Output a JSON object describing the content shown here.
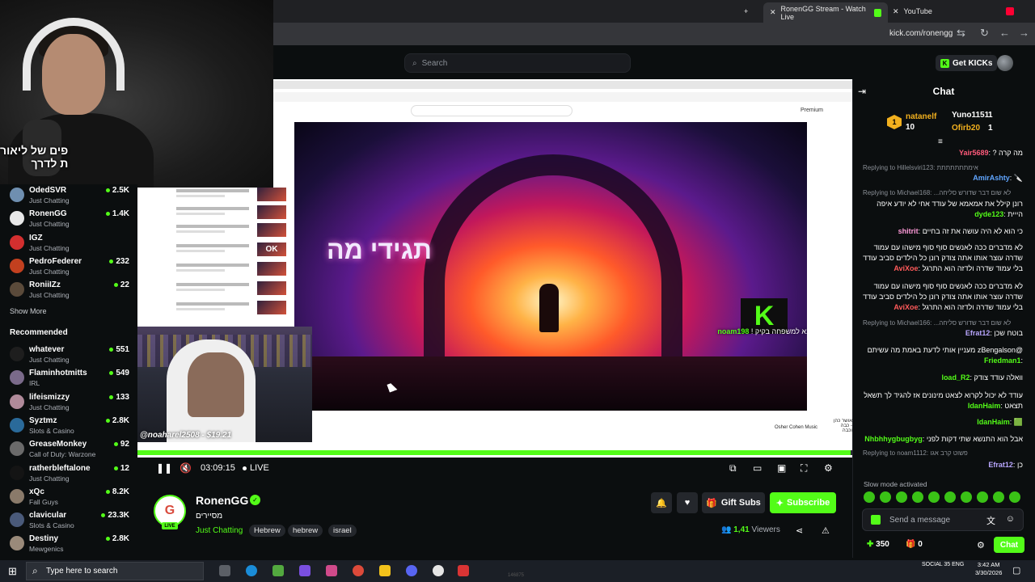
{
  "browser": {
    "tabs": [
      {
        "label": "RonenGG Stream - Watch Live",
        "active": true
      },
      {
        "label": "YouTube",
        "active": false
      }
    ],
    "url": "kick.com/ronengg"
  },
  "header": {
    "search_placeholder": "Search",
    "get_kicks_label": "Get KICKs"
  },
  "sidebar": {
    "following": [
      {
        "name": "OdedSVR",
        "category": "Just Chatting",
        "viewers": "2.5K",
        "avatar_color": "#6f8fb0"
      },
      {
        "name": "RonenGG",
        "category": "Just Chatting",
        "viewers": "1.4K",
        "avatar_color": "#e8e8e8"
      },
      {
        "name": "IGZ",
        "category": "Just Chatting",
        "viewers": "",
        "avatar_color": "#d32f2f"
      },
      {
        "name": "PedroFederer",
        "category": "Just Chatting",
        "viewers": "232",
        "avatar_color": "#c2401f"
      },
      {
        "name": "RoniiIZz",
        "category": "Just Chatting",
        "viewers": "22",
        "avatar_color": "#5a4a3a"
      }
    ],
    "show_more_label": "Show More",
    "recommended_label": "Recommended",
    "recommended": [
      {
        "name": "whatever",
        "category": "Just Chatting",
        "viewers": "551",
        "avatar_color": "#1e1e1e"
      },
      {
        "name": "Flaminhotmitts",
        "category": "IRL",
        "viewers": "549",
        "avatar_color": "#7a6a8a"
      },
      {
        "name": "lifeismizzy",
        "category": "Just Chatting",
        "viewers": "133",
        "avatar_color": "#b08a9a"
      },
      {
        "name": "Syztmz",
        "category": "Slots & Casino",
        "viewers": "2.8K",
        "avatar_color": "#2a6a9a"
      },
      {
        "name": "GreaseMonkey",
        "category": "Call of Duty: Warzone",
        "viewers": "92",
        "avatar_color": "#6a6a6a"
      },
      {
        "name": "ratherbleftalone",
        "category": "Just Chatting",
        "viewers": "12",
        "avatar_color": "#141414"
      },
      {
        "name": "xQc",
        "category": "Fall Guys",
        "viewers": "8.2K",
        "avatar_color": "#8a7a6a"
      },
      {
        "name": "clavicular",
        "category": "Slots & Casino",
        "viewers": "23.3K",
        "avatar_color": "#4a5a7a"
      },
      {
        "name": "Destiny",
        "category": "Mewgenics",
        "viewers": "2.8K",
        "avatar_color": "#9a8a7a"
      }
    ]
  },
  "video": {
    "art_title": "תגידי מה",
    "overlay_caption": "פים של ליאור",
    "overlay_caption2": "ת לדרך",
    "alert_user": "noam198",
    "alert_text": "ברוך הבא למשפחה בקיק !",
    "donation_text": "@noaharel2508 - $19.21",
    "kick_letter": "K",
    "progress": 0.998,
    "timecode": "03:09:15",
    "live_label": "LIVE",
    "inner_page": {
      "premium_label": "Premium",
      "song_title": "אושר כהן - כבה וכבה",
      "song_channel": "Osher Cohen Music",
      "overlay_ok": "OK"
    }
  },
  "channel": {
    "name": "RonenGG",
    "live_badge": "LIVE",
    "title": "מסיירים",
    "category": "Just Chatting",
    "tags": [
      "Hebrew",
      "hebrew",
      "israel"
    ],
    "gift_subs_label": "Gift Subs",
    "subscribe_label": "Subscribe",
    "viewer_count": "1,41",
    "viewers_label": "Viewers"
  },
  "chat": {
    "title": "Chat",
    "leaderboard": [
      {
        "name": "natanelf",
        "points": "10",
        "rank": "1"
      },
      {
        "name": "Yuno1151",
        "points": "1"
      },
      {
        "name": "Ofirb20",
        "points": "1"
      }
    ],
    "messages": [
      {
        "type": "msg",
        "user": "Yair5689",
        "color": "#ff5a7a",
        "text": "מה קרה ?"
      },
      {
        "type": "reply",
        "text": "Replying to Hillelsviri123: אימתתתתתתת"
      },
      {
        "type": "msg",
        "user": "AmirAshty",
        "color": "#60a5ff",
        "text": "🔪"
      },
      {
        "type": "reply",
        "text": "Replying to Michael168: ...לא שום דבר שדורש סליחה"
      },
      {
        "type": "msg",
        "user": "dyde123",
        "color": "#53fc18",
        "text": "רונן קילל את אמאמא של עודד אחי לא יודע איפה הייית"
      },
      {
        "type": "msg",
        "user": "shitrit",
        "color": "#ff9ad9",
        "text": "כי הוא לא היה עושה את זה בחיים"
      },
      {
        "type": "msg",
        "user": "AviXoe",
        "color": "#ff5a5a",
        "text": "לא מדברים ככה לאנשים סוף סוף מישהו עם עמוד שדרה עוצר אותו אתה צודק רונן כל הילדים סביב עודד בלי עמוד שדרה ולדזה הוא התרגל"
      },
      {
        "type": "msg",
        "user": "AviXoe",
        "color": "#ff5a5a",
        "text": "לא מדברים ככה לאנשים סוף סוף מישהו עם עמוד שדרה עוצר אותו אתה צודק רונן כל הילדים סביב עודד בלי עמוד שדרה ולדזה הוא התרגל"
      },
      {
        "type": "reply",
        "text": "Replying to Michael166: ...לא שום דבר שדורש סליחה"
      },
      {
        "type": "msg",
        "user": "Efrat12",
        "color": "#b9a7ff",
        "text": "בוטח שכן"
      },
      {
        "type": "msg",
        "user": "Friedman1",
        "color": "#53fc18",
        "text": "@zBengalson מעניין אותי לדעת באמת מה עשיתם"
      },
      {
        "type": "msg",
        "user": "load_R2",
        "color": "#53fc18",
        "text": "וואלה עודד צודק"
      },
      {
        "type": "msg",
        "user": "IdanHaim",
        "color": "#53fc18",
        "text": "עודד לא יכול לקרוא לצאט מינונים אז להגיד לך תשאל תצאט"
      },
      {
        "type": "msg",
        "user": "IdanHaim",
        "color": "#53fc18",
        "text": "🟩"
      },
      {
        "type": "msg",
        "user": "Nhbhhygbugbyg",
        "color": "#53fc18",
        "text": "אבל הוא התנשא שתי דקות לפני"
      },
      {
        "type": "reply",
        "text": "Replying to noam1112: פשוט קרב אגו"
      },
      {
        "type": "msg",
        "user": "Efrat12",
        "color": "#b9a7ff",
        "text": "כן"
      }
    ],
    "slow_mode_label": "Slow mode activated",
    "input_placeholder": "Send a message",
    "kicks_count": "350",
    "gifts_count": "0",
    "chat_button_label": "Chat"
  },
  "taskbar": {
    "search_placeholder": "Type here to search",
    "language": "ENG",
    "time": "3:42 AM",
    "date": "3/30/2026",
    "social_label": "SOCIAL",
    "social_count": "35",
    "task_count": "146875"
  },
  "colors": {
    "accent": "#53fc18",
    "background": "#0b0e0f"
  }
}
